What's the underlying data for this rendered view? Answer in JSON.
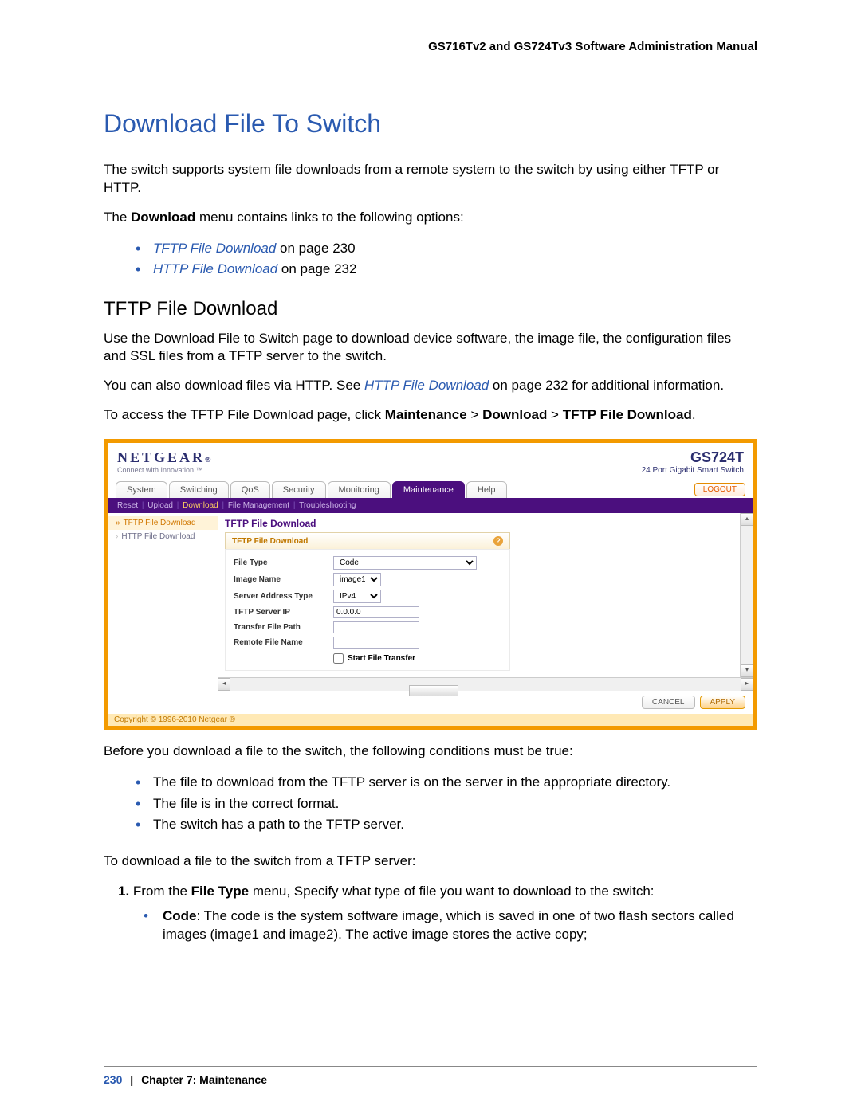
{
  "doc": {
    "header": "GS716Tv2 and GS724Tv3 Software Administration Manual"
  },
  "h1": "Download File To Switch",
  "intro1_a": "The switch supports system file downloads from a remote system to the switch by using either TFTP or HTTP.",
  "intro2_a": "The ",
  "intro2_b": "Download",
  "intro2_c": " menu contains links to the following options:",
  "links": {
    "item1_link": "TFTP File Download",
    "item1_rest": " on page 230",
    "item2_link": "HTTP File Download",
    "item2_rest": " on page 232"
  },
  "h2": "TFTP File Download",
  "p1": "Use the Download File to Switch page to download device software, the image file, the configuration files and SSL files from a TFTP server to the switch.",
  "p2_a": "You can also download files via HTTP. See ",
  "p2_link": "HTTP File Download",
  "p2_b": " on page 232 for additional information.",
  "p3_a": "To access the TFTP File Download page, click ",
  "p3_b": "Maintenance",
  "p3_c": "Download",
  "p3_d": "TFTP File Download",
  "p3_gt": " > ",
  "p3_end": ".",
  "shot": {
    "logo": "NETGEAR",
    "logo_tm": "®",
    "tagline": "Connect with Innovation ™",
    "model": "GS724T",
    "model_sub": "24 Port Gigabit Smart Switch",
    "tabs": [
      "System",
      "Switching",
      "QoS",
      "Security",
      "Monitoring",
      "Maintenance",
      "Help"
    ],
    "active_tab": "Maintenance",
    "logout": "LOGOUT",
    "subnav": [
      "Reset",
      "Upload",
      "Download",
      "File Management",
      "Troubleshooting"
    ],
    "subnav_active": "Download",
    "side": {
      "item1": "TFTP File Download",
      "item2": "HTTP File Download"
    },
    "panel_title": "TFTP File Download",
    "panel_sub": "TFTP File Download",
    "help_glyph": "?",
    "form": {
      "file_type_label": "File Type",
      "file_type_value": "Code",
      "image_name_label": "Image Name",
      "image_name_value": "image1",
      "addr_type_label": "Server Address Type",
      "addr_type_value": "IPv4",
      "server_ip_label": "TFTP Server IP",
      "server_ip_value": "0.0.0.0",
      "transfer_path_label": "Transfer File Path",
      "transfer_path_value": "",
      "remote_name_label": "Remote File Name",
      "remote_name_value": "",
      "start_label": "Start File Transfer"
    },
    "cancel": "CANCEL",
    "apply": "APPLY",
    "copyright": "Copyright © 1996-2010 Netgear ®"
  },
  "after1": "Before you download a file to the switch, the following conditions must be true:",
  "cond1": "The file to download from the TFTP server is on the server in the appropriate directory.",
  "cond2": "The file is in the correct format.",
  "cond3": "The switch has a path to the TFTP server.",
  "after2": "To download a file to the switch from a TFTP server:",
  "step1_num": "1.",
  "step1_a": "From the ",
  "step1_b": "File Type",
  "step1_c": " menu, Specify what type of file you want to download to the switch:",
  "step1_bullet_a": "Code",
  "step1_bullet_b": ": The code is the system software image, which is saved in one of two flash sectors called images (image1 and image2). The active image stores the active copy;",
  "footer": {
    "page": "230",
    "chapter": "Chapter 7:  Maintenance"
  }
}
